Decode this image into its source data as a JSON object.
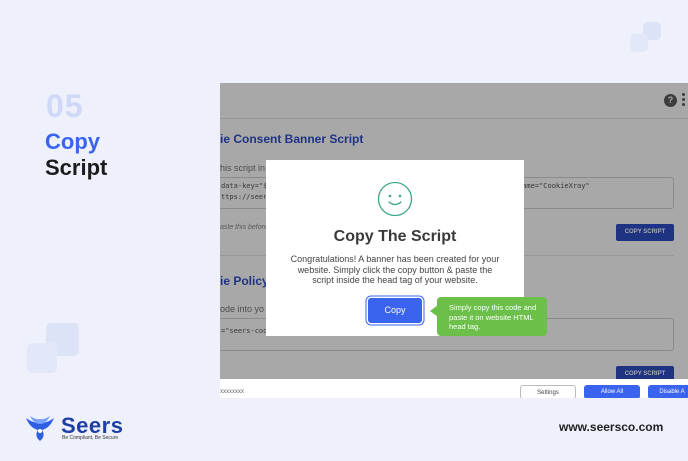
{
  "slide": {
    "step_number": "05",
    "step_title_line1": "Copy",
    "step_title_line2": "Script",
    "website": "www.seersco.com"
  },
  "logo": {
    "name": "Seers",
    "tagline": "Be Compliant, Be Secure"
  },
  "app": {
    "section1_title": "ie Consent Banner Script",
    "section1_subtitle": "his script in",
    "code1_line1": "data-key=\"$",
    "code1_line2": "ttps://seersc",
    "code1_right": "name=\"CookieXray\"",
    "note1": "aste this before",
    "copy_script_label": "COPY SCRIPT",
    "section2_title": "ie Policy",
    "section2_subtitle": "ode into yo",
    "code2_line1": "=\"seers-cooki",
    "bar_text": "xxxxxxxx",
    "settings_label": "Settings",
    "allow_label": "Allow All",
    "disable_label": "Disable A"
  },
  "modal": {
    "title": "Copy The Script",
    "body": "Congratulations! A banner has been created for your website. Simply click the copy button & paste the script inside the head tag of your website.",
    "copy_label": "Copy"
  },
  "tooltip": {
    "text": "Simply copy this code and paste it on website HTML head tag."
  },
  "colors": {
    "accent": "#3b64ee",
    "tooltip": "#6cc04a",
    "background": "#eef1fb"
  }
}
